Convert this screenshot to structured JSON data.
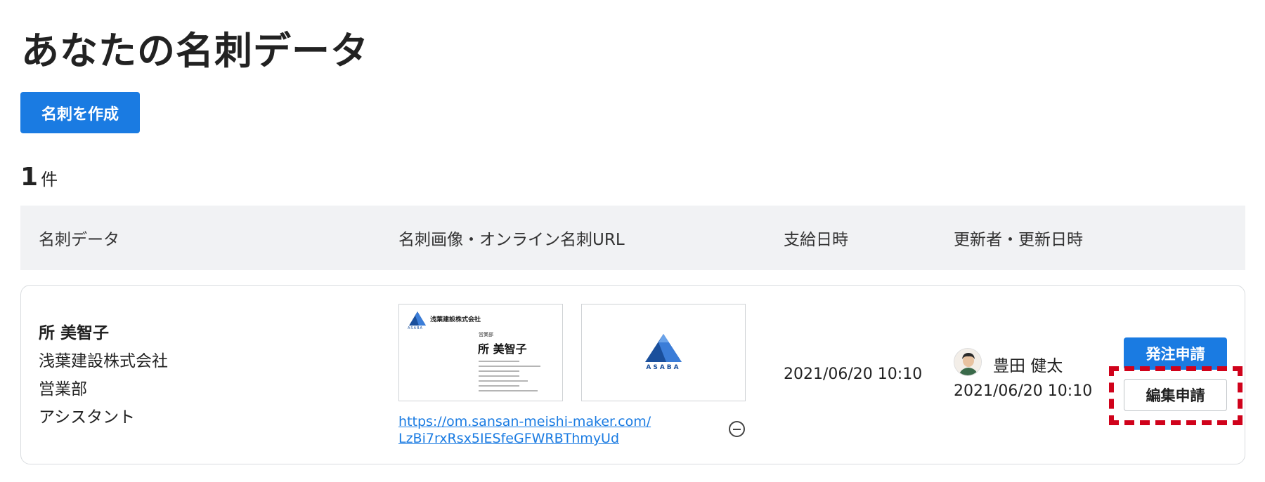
{
  "page": {
    "title": "あなたの名刺データ",
    "create_button": "名刺を作成",
    "count_number": "1",
    "count_unit": "件"
  },
  "table": {
    "columns": [
      "名刺データ",
      "名刺画像・オンライン名刺URL",
      "支給日時",
      "更新者・更新日時"
    ],
    "rows": [
      {
        "name": "所 美智子",
        "company": "浅葉建設株式会社",
        "department": "営業部",
        "position": "アシスタント",
        "card_front": {
          "company": "浅葉建設株式会社",
          "logo_text": "ASABA",
          "department": "営業部",
          "name": "所 美智子"
        },
        "card_back": {
          "logo_text": "ASABA"
        },
        "url": "https://om.sansan-meishi-maker.com/LzBi7rxRsx5IESfeGFWRBThmyUd",
        "issued_at": "2021/06/20 10:10",
        "updater_name": "豊田 健太",
        "updated_at": "2021/06/20 10:10",
        "order_button": "発注申請",
        "edit_button": "編集申請"
      }
    ]
  },
  "colors": {
    "primary": "#1a7be2",
    "header_bg": "#f1f2f4",
    "highlight": "#d0021b",
    "logo_blue": "#1a4f9c"
  }
}
